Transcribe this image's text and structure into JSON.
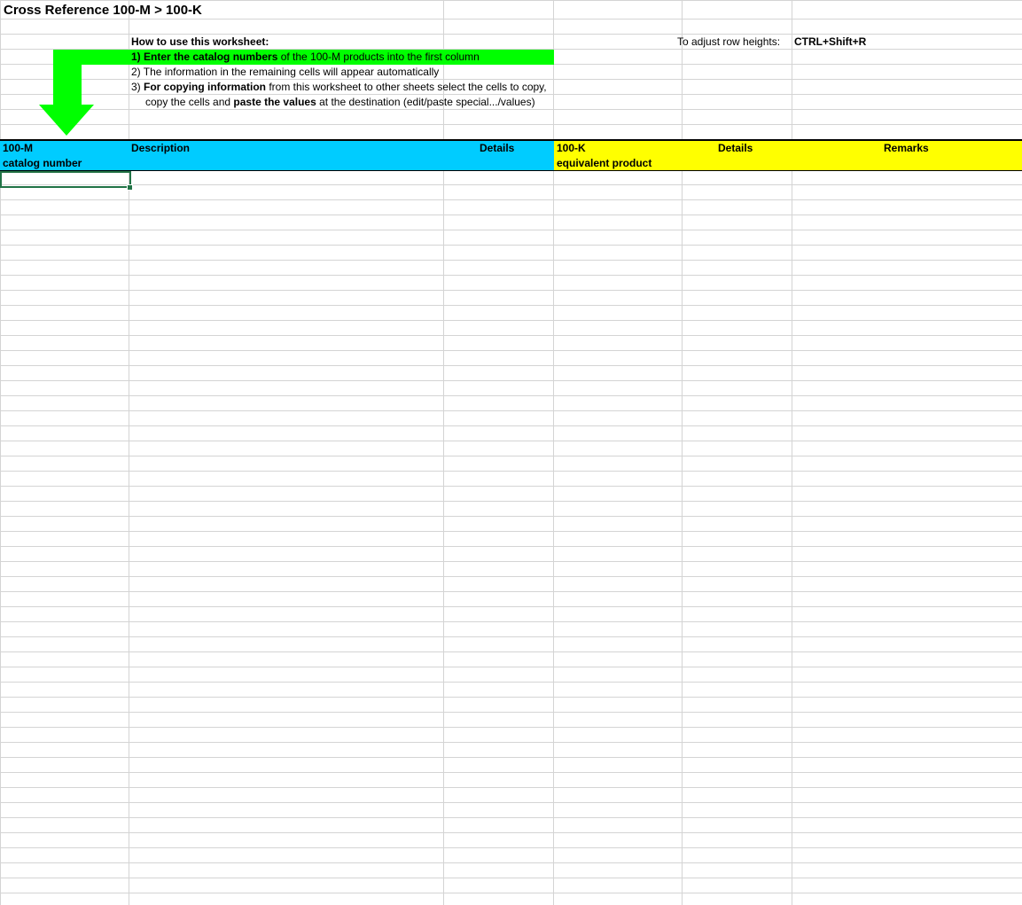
{
  "sheet": {
    "title": "Cross Reference 100-M > 100-K",
    "instructions": {
      "heading": "How to use this worksheet:",
      "step1_bold": "1) Enter the catalog numbers",
      "step1_rest": " of the 100-M products into the first column",
      "step2": "2) The information in the remaining cells will appear automatically",
      "step3_prefix": "3) ",
      "step3_bold": "For copying information",
      "step3_rest": " from this worksheet to other sheets select the cells to copy,",
      "step3b_prefix": "copy the cells and ",
      "step3b_bold": "paste the values",
      "step3b_rest": " at the destination (edit/paste special.../values)"
    },
    "row_height_hint": {
      "label": "To adjust row heights:",
      "shortcut": "CTRL+Shift+R"
    },
    "headers": {
      "col1_line1": "100-M",
      "col1_line2": "catalog number",
      "col2": "Description",
      "col3": "Details",
      "col4_line1": "100-K",
      "col4_line2": "equivalent product",
      "col5": "Details",
      "col6": "Remarks"
    },
    "colors": {
      "highlight_green": "#00ff00",
      "header_blue": "#00ccff",
      "header_yellow": "#ffff00",
      "arrow_green": "#00ff00",
      "selection": "#217346",
      "gridline": "#d4d4d4"
    },
    "icons": {
      "arrow": "arrow-down-icon"
    }
  }
}
